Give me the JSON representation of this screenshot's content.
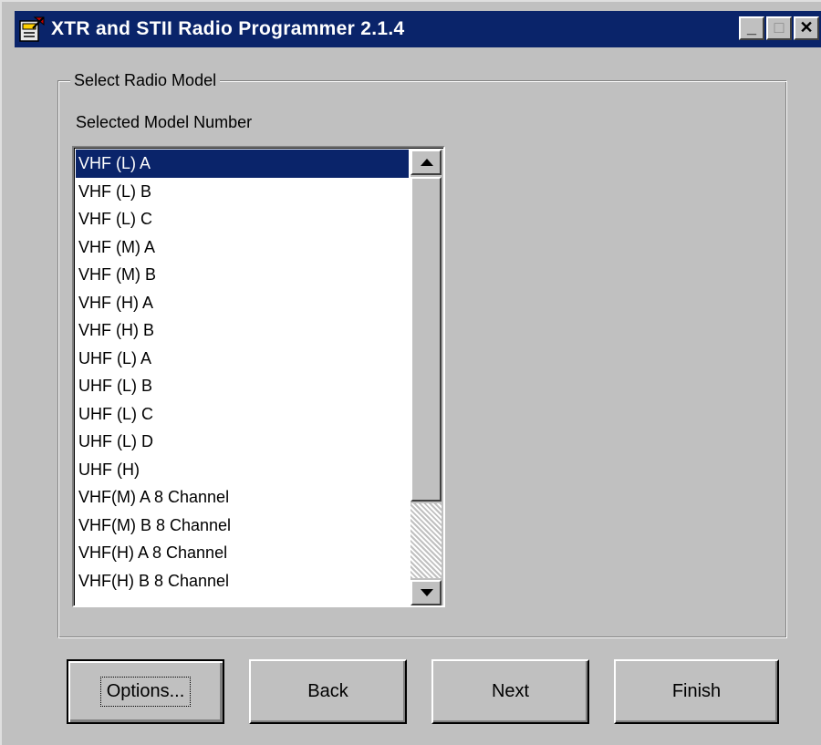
{
  "window": {
    "title": "XTR and STII Radio Programmer 2.1.4",
    "controls": {
      "minimize": "_",
      "maximize": "□",
      "close": "✕"
    }
  },
  "group": {
    "legend": "Select Radio Model",
    "sublabel": "Selected Model Number"
  },
  "models": [
    "VHF (L) A",
    "VHF (L) B",
    "VHF (L) C",
    "VHF (M) A",
    "VHF (M) B",
    "VHF (H) A",
    "VHF (H) B",
    "UHF (L) A",
    "UHF (L) B",
    "UHF (L) C",
    "UHF (L) D",
    "UHF (H)",
    "VHF(M) A 8 Channel",
    "VHF(M) B 8 Channel",
    "VHF(H) A 8 Channel",
    "VHF(H) B 8 Channel"
  ],
  "selected_model": "VHF (L) A",
  "buttons": {
    "options": "Options...",
    "back": "Back",
    "next": "Next",
    "finish": "Finish"
  },
  "colors": {
    "titlebar": "#0a246a",
    "face": "#c0c0c0",
    "selection": "#0a246a"
  },
  "icons": [
    "app-icon",
    "scroll-up-arrow-icon",
    "scroll-down-arrow-icon"
  ]
}
